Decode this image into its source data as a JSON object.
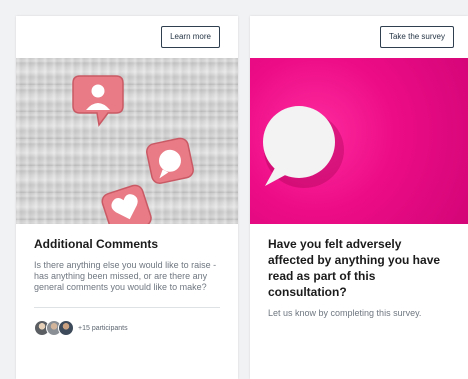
{
  "cards": [
    {
      "button_label": "Learn more",
      "title": "Additional Comments",
      "description": "Is there anything else you would like to raise - has anything been missed, or are there any general comments you would like to make?",
      "participants_label": "+15 participants"
    },
    {
      "button_label": "Take the survey",
      "title": "Have you felt adversely affected by anything you have read as part of this consultation?",
      "description": "Let us know by completing this survey."
    }
  ],
  "icons": [
    "user-profile-icon",
    "speech-bubble-icon",
    "heart-icon",
    "speech-bubble-icon"
  ],
  "colors": {
    "accent_pink": "#e90e84",
    "badge_pink": "#e77b84",
    "button_border": "#2f3f4f",
    "muted_text": "#6f7780"
  }
}
